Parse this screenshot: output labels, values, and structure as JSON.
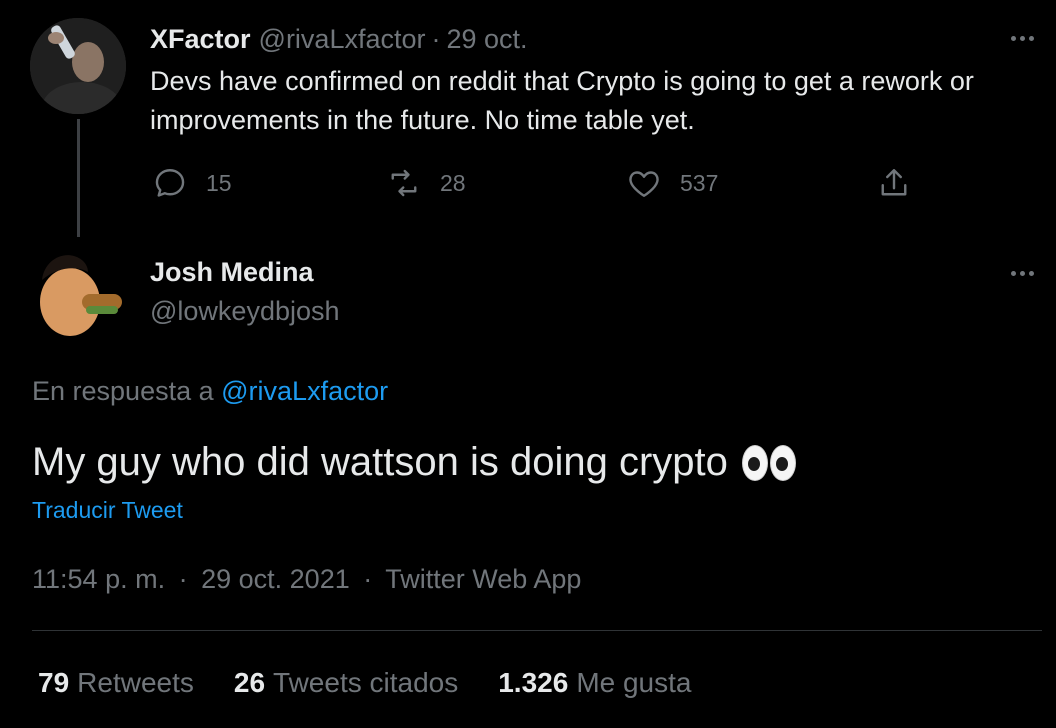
{
  "parent_tweet": {
    "display_name": "XFactor",
    "handle": "@rivaLxfactor",
    "separator": "·",
    "date": "29 oct.",
    "text": "Devs have confirmed on reddit that Crypto is going to get a rework or improvements in the future. No time table yet.",
    "replies": "15",
    "retweets": "28",
    "likes": "537",
    "icons": [
      "reply-icon",
      "retweet-icon",
      "like-icon",
      "share-icon",
      "more-icon"
    ]
  },
  "main_tweet": {
    "display_name": "Josh Medina",
    "handle": "@lowkeydbjosh",
    "reply_prefix": "En respuesta a",
    "reply_mention": "@rivaLxfactor",
    "text": "My guy who did wattson is doing crypto",
    "emoji": "eyes-emoji",
    "translate_link": "Traducir Tweet",
    "time": "11:54 p. m.",
    "separator": "·",
    "date": "29 oct. 2021",
    "source": "Twitter Web App",
    "stats": {
      "retweets_count": "79",
      "retweets_label": "Retweets",
      "quotes_count": "26",
      "quotes_label": "Tweets citados",
      "likes_count": "1.326",
      "likes_label": "Me gusta"
    }
  },
  "colors": {
    "background": "#000000",
    "text_primary": "#e7e9ea",
    "text_secondary": "#71767b",
    "link": "#1d9bf0",
    "divider": "#2f3336"
  }
}
